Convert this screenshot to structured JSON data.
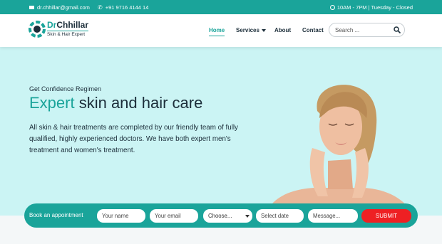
{
  "topbar": {
    "email": "dr.chhillar@gmail.com",
    "phone": "+91 9716 4144 14",
    "hours": "10AM - 7PM | Tuesday - Closed"
  },
  "logo": {
    "title_prefix": "Dr",
    "title_main": "Chhillar",
    "tagline": "Skin & Hair Expert"
  },
  "nav": {
    "items": [
      {
        "label": "Home",
        "active": true
      },
      {
        "label": "Services",
        "has_dropdown": true
      },
      {
        "label": "About"
      },
      {
        "label": "Contact"
      }
    ]
  },
  "search": {
    "placeholder": "Search ..."
  },
  "hero": {
    "subtitle": "Get Confidence Regimen",
    "headline_accent": "Expert",
    "headline_rest": " skin and hair care",
    "description": "All skin & hair treatments are completed by our friendly team of fully qualified, highly experienced doctors. We have both expert men's treatment and women's treatment."
  },
  "appointment": {
    "label": "Book an appointment",
    "name_placeholder": "Your name",
    "email_placeholder": "Your email",
    "select_value": "Choose...",
    "date_placeholder": "Select date",
    "message_placeholder": "Message...",
    "submit_label": "SUBMIT"
  },
  "colors": {
    "accent": "#1aa49a",
    "hero_bg": "#cbf4f4",
    "dark_text": "#1c2e3a",
    "submit": "#ee2023"
  },
  "icons": [
    "mail-icon",
    "phone-icon",
    "clock-icon",
    "search-icon",
    "chevron-down-icon"
  ]
}
